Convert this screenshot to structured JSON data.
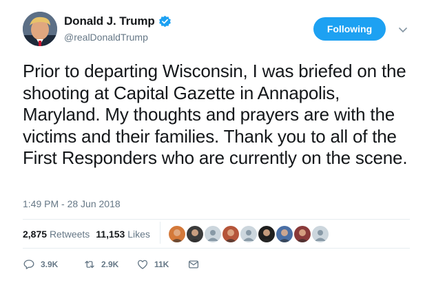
{
  "author": {
    "display_name": "Donald J. Trump",
    "handle": "@realDonaldTrump",
    "verified": true,
    "avatar_icon": "profile-photo"
  },
  "follow_button": {
    "label": "Following"
  },
  "menu": {
    "icon": "chevron-down-icon"
  },
  "tweet": {
    "text": "Prior to departing Wisconsin, I was briefed on the shooting at Capital Gazette in Annapolis, Maryland. My thoughts and prayers are with the victims and their families. Thank you to all of the First Responders who are currently on the scene.",
    "timestamp": "1:49 PM - 28 Jun 2018"
  },
  "stats": {
    "retweets_count": "2,875",
    "retweets_label": "Retweets",
    "likes_count": "11,153",
    "likes_label": "Likes"
  },
  "likers": [
    {
      "icon": "liker-avatar",
      "color": "#d4793a"
    },
    {
      "icon": "liker-avatar",
      "color": "#3b3b3b"
    },
    {
      "icon": "default-avatar",
      "color": "#ccd6dd"
    },
    {
      "icon": "liker-avatar",
      "color": "#b5553a"
    },
    {
      "icon": "default-avatar",
      "color": "#ccd6dd"
    },
    {
      "icon": "liker-avatar",
      "color": "#1f1f1f"
    },
    {
      "icon": "liker-avatar",
      "color": "#4a6fa5"
    },
    {
      "icon": "liker-avatar",
      "color": "#8a3a3a"
    },
    {
      "icon": "default-avatar",
      "color": "#ccd6dd"
    }
  ],
  "actions": {
    "replies": "3.9K",
    "retweets": "2.9K",
    "likes": "11K"
  },
  "colors": {
    "accent": "#1da1f2",
    "text": "#14171a",
    "secondary": "#657786",
    "retweet_icon": "#17bf63"
  }
}
